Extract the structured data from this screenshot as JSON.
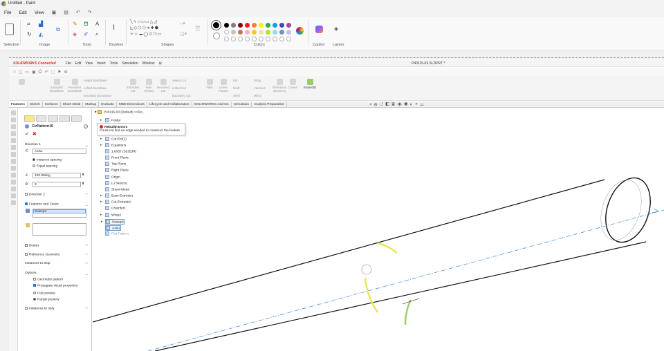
{
  "paint": {
    "window_title": "Untitled - Paint",
    "menu": [
      "File",
      "Edit",
      "View"
    ],
    "groups": {
      "selection": "Selection",
      "image": "Image",
      "tools": "Tools",
      "brushes": "Brushes",
      "shapes": "Shapes",
      "colors": "Colors",
      "copilot": "Copilot",
      "layers": "Layers"
    },
    "colors_row1": [
      "#000000",
      "#7f7f7f",
      "#880015",
      "#ed1c24",
      "#ff7f27",
      "#fff200",
      "#22b14c",
      "#00a2e8",
      "#3f48cc",
      "#a349a4"
    ],
    "colors_row2": [
      "#ffffff",
      "#c3c3c3",
      "#b97a57",
      "#ffaec9",
      "#ffc90e",
      "#efe4b0",
      "#b5e61d",
      "#99d9ea",
      "#7092be",
      "#c8bfe7"
    ]
  },
  "sw": {
    "brand": "SOLIDWORKS Connected",
    "menu": [
      "File",
      "Edit",
      "View",
      "Insert",
      "Tools",
      "Simulation",
      "Window"
    ],
    "doc_title": "P40115-03.SLDPRT *",
    "commands": [
      "Extruded Boss/Base",
      "Revolved Boss/Base",
      "Swept Boss/Base",
      "Lofted Boss/Base",
      "Boundary Boss/Base",
      "Extruded Cut",
      "Hole Wizard",
      "Revolved Cut",
      "Swept Cut",
      "Lofted Cut",
      "Boundary Cut",
      "Fillet",
      "Linear Pattern",
      "Rib",
      "Draft",
      "Shell",
      "Wrap",
      "Intersect",
      "Mirror",
      "Reference Geometry",
      "Curves",
      "Instant3D"
    ],
    "tabs": [
      "Features",
      "Sketch",
      "Surfaces",
      "Sheet Metal",
      "Markup",
      "Evaluate",
      "MBD Dimensions",
      "Lifecycle and Collaboration",
      "SOLIDWORKS Add-Ins",
      "Simulation",
      "Analysis Preparation"
    ]
  },
  "pm": {
    "title": "CirPattern15",
    "direction1": "Direction 1",
    "axis_value": "Axis1",
    "instance_spacing": "Instance spacing",
    "equal_spacing": "Equal spacing",
    "angle": "120.00deg",
    "count": "3",
    "direction2": "Direction 2",
    "features_faces": "Features and Faces",
    "selected_feature": "Sweep1",
    "bodies": "Bodies",
    "reference_geometry": "Reference Geometry",
    "instances_to_skip": "Instances to Skip",
    "options": "Options",
    "geometry_pattern": "Geometry pattern",
    "propagate": "Propagate visual properties",
    "full_preview": "Full preview",
    "partial_preview": "Partial preview",
    "instances_to_vary": "Instances to Vary"
  },
  "tree": {
    "root": "P40115-03 (Default) <<De...",
    "items": [
      "Folder",
      "Cut-Ext(1)",
      "Equations",
      "1.0037 (S235JR)",
      "Front Plane",
      "Top Plane",
      "Right Plane",
      "Origin",
      "(-) Sketch1",
      "Sheet-Metal",
      "Boss-Extrude1",
      "Cut-Extrude1",
      "Chamfer1",
      "Wrap2",
      "Sweep1",
      "Axis1",
      "Flat-Pattern"
    ]
  },
  "tooltip": {
    "title": "Rebuild Errors",
    "text": "Could not find an edge needed to construct the feature"
  }
}
